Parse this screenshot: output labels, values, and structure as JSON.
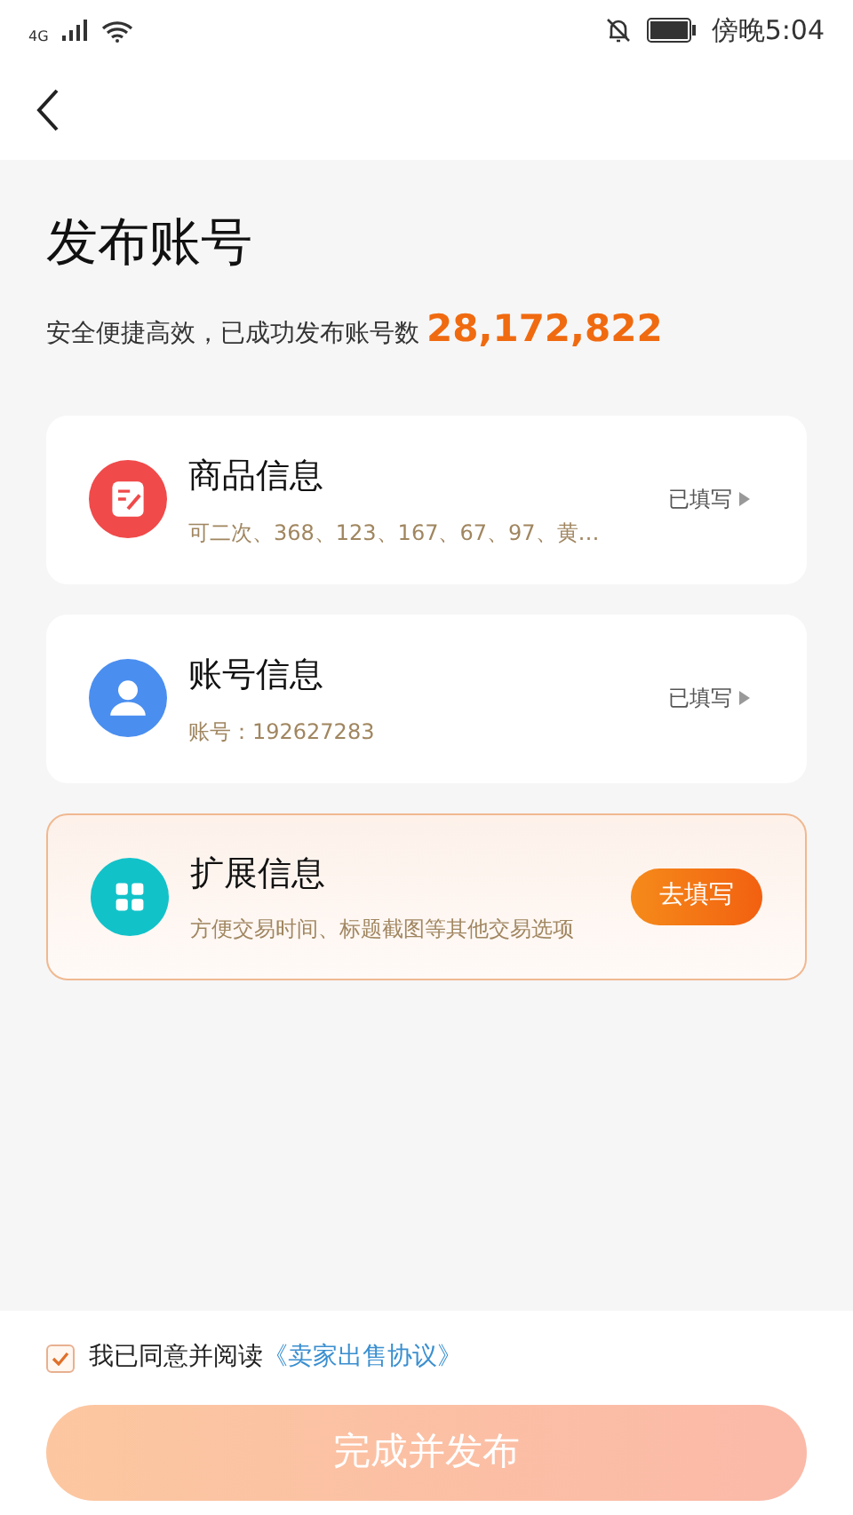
{
  "status_bar": {
    "network": "4G",
    "time": "傍晚5:04"
  },
  "page": {
    "title": "发布账号",
    "subtitle": "安全便捷高效，已成功发布账号数",
    "count": "28,172,822"
  },
  "sections": [
    {
      "kind": "filled",
      "color": "#f04a4a",
      "title": "商品信息",
      "detail": "可二次、368、123、167、67、97、黄…",
      "action": "已填写"
    },
    {
      "kind": "filled",
      "color": "#4a8ef0",
      "title": "账号信息",
      "detail": "账号：192627283",
      "action": "已填写"
    },
    {
      "kind": "action",
      "color": "#12c2c9",
      "title": "扩展信息",
      "detail": "方便交易时间、标题截图等其他交易选项",
      "action": "去填写"
    }
  ],
  "agreement": {
    "checked": true,
    "text": "我已同意并阅读",
    "link": "《卖家出售协议》"
  },
  "submit_button": "完成并发布"
}
